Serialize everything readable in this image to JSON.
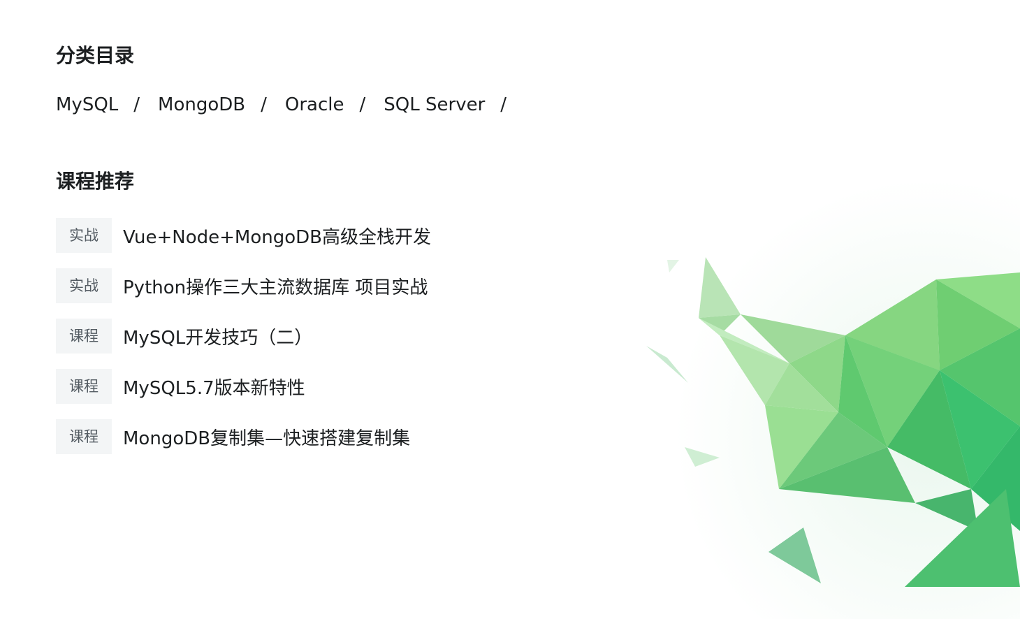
{
  "categories": {
    "title": "分类目录",
    "separator": "/",
    "items": [
      "MySQL",
      "MongoDB",
      "Oracle",
      "SQL Server"
    ]
  },
  "courses": {
    "title": "课程推荐",
    "items": [
      {
        "tag": "实战",
        "title": "Vue+Node+MongoDB高级全栈开发"
      },
      {
        "tag": "实战",
        "title": "Python操作三大主流数据库 项目实战"
      },
      {
        "tag": "课程",
        "title": "MySQL开发技巧（二）"
      },
      {
        "tag": "课程",
        "title": "MySQL5.7版本新特性"
      },
      {
        "tag": "课程",
        "title": "MongoDB复制集—快速搭建复制集"
      }
    ]
  },
  "colors": {
    "text": "#1c1f21",
    "tag_bg": "#f3f5f6",
    "tag_text": "#545c63",
    "accent_green": "#3cc16f"
  },
  "decoration": {
    "icon": "polygonal-green-leaf-illustration"
  }
}
